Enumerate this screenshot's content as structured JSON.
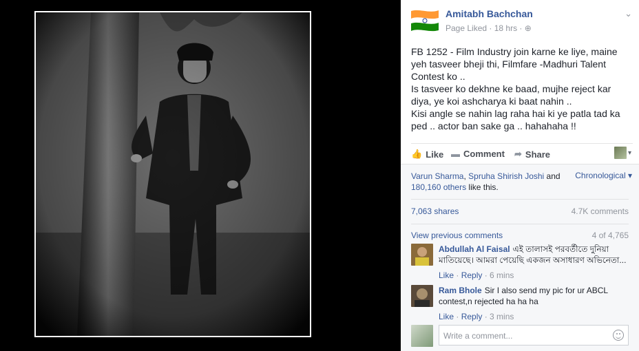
{
  "post": {
    "page_name": "Amitabh Bachchan",
    "meta": "Page Liked · 18 hrs · ",
    "globe": "⊕",
    "chevron": "⌄",
    "text": "FB 1252 - Film Industry join karne ke liye, maine yeh tasveer bheji thi, Filmfare -Madhuri Talent Contest ko ..\nIs tasveer ko dekhne ke baad, mujhe reject kar diya, ye koi ashcharya ki baat nahin ..\nKisi angle se nahin lag raha hai ki ye patla tad ka ped .. actor ban sake ga .. hahahaha !!"
  },
  "actions": {
    "like": "Like",
    "comment": "Comment",
    "share": "Share",
    "like_icon": "👍",
    "comment_icon": "▬",
    "share_icon": "➦",
    "view_as_caret": "▾"
  },
  "feedback": {
    "liker1": "Varun Sharma",
    "sep": ", ",
    "liker2": "Spruha Shirish Joshi",
    "and": " and",
    "others": "180,160 others",
    "like_this": " like this.",
    "order": "Chronological ▾",
    "shares": "7,063 shares",
    "comments_count": "4.7K comments",
    "view_previous": "View previous comments",
    "count": "4 of 4,765"
  },
  "comments": [
    {
      "name": "Abdullah Al Faisal",
      "text": "এই তালাস‌ই পরবর্তীতে দুনিয়া মাতিয়েছে। আমরা পেয়েছি একজন অসাধারণ অভিনেতা...",
      "like": "Like",
      "reply": "Reply",
      "time": "6 mins"
    },
    {
      "name": "Ram Bhole",
      "text": "Sir I also send my pic for ur ABCL contest,n rejected ha ha ha",
      "like": "Like",
      "reply": "Reply",
      "time": "3 mins"
    }
  ],
  "dot": " · ",
  "composer": {
    "placeholder": "Write a comment..."
  },
  "colors": {
    "link": "#365899",
    "saffron": "#ff9933",
    "green": "#138808"
  }
}
